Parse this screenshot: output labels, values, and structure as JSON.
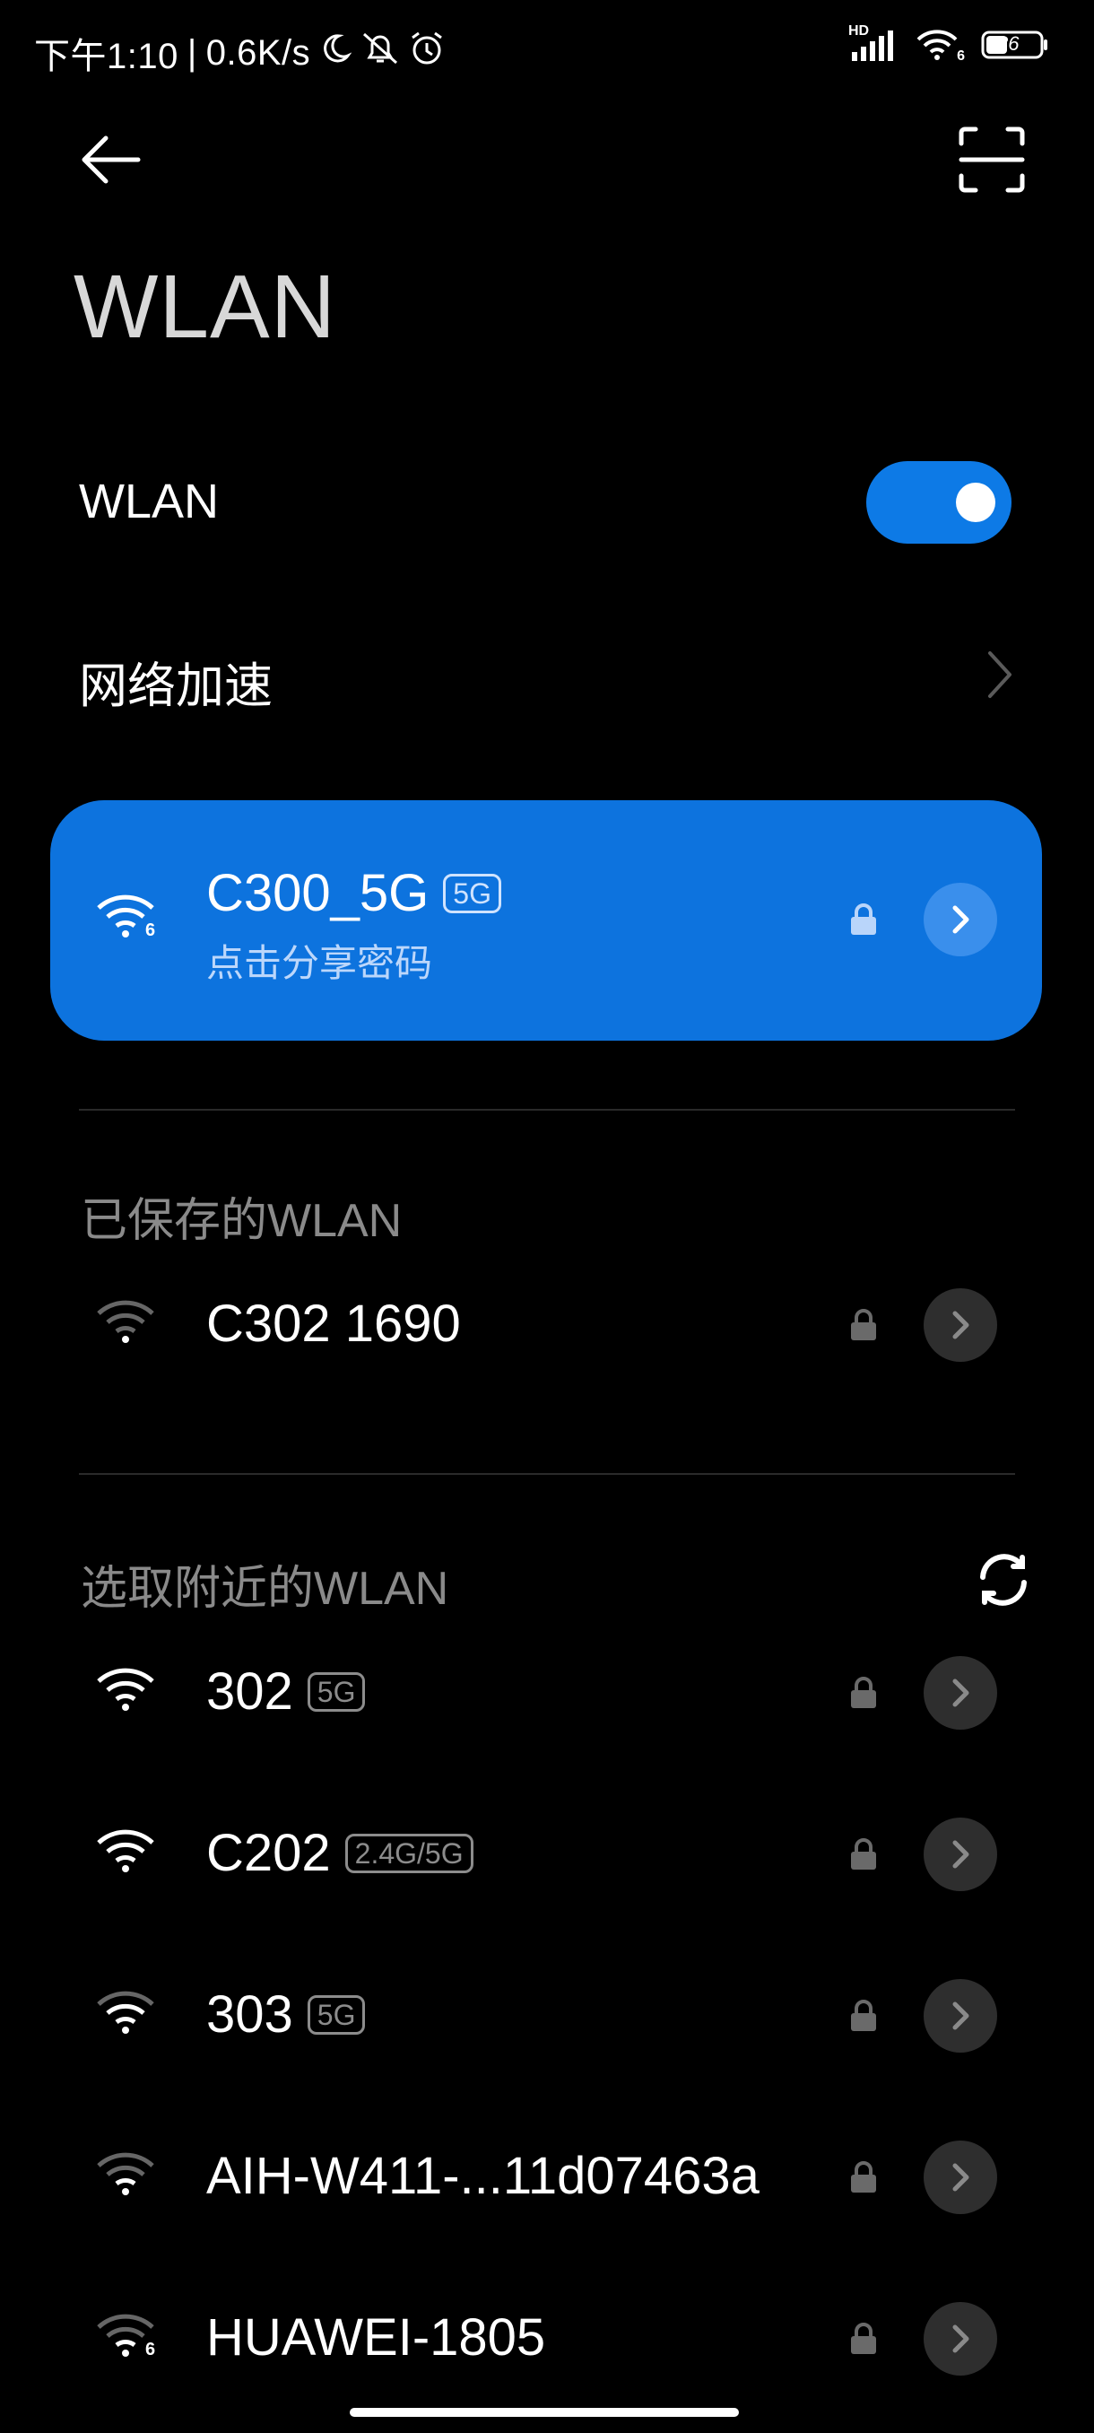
{
  "status_bar": {
    "time": "下午1:10",
    "separator": "|",
    "speed": "0.6K/s",
    "network_label": "HD",
    "wifi_sub": "6",
    "battery": "36",
    "icons": [
      "moon-icon",
      "muted-bell-icon",
      "alarm-icon",
      "signal-icon",
      "wifi-icon",
      "battery-icon"
    ]
  },
  "header": {
    "title": "WLAN",
    "icons": [
      "back-arrow-icon",
      "scan-qr-icon"
    ]
  },
  "wlan_toggle": {
    "label": "WLAN",
    "on": true
  },
  "network_accel": {
    "label": "网络加速"
  },
  "connected": {
    "name": "C300_5G",
    "band": "5G",
    "subtitle": "点击分享密码",
    "wifi_gen": "6",
    "color": "#0d73de"
  },
  "saved": {
    "title": "已保存的WLAN",
    "items": [
      {
        "name": "C302 1690"
      }
    ]
  },
  "nearby": {
    "title": "选取附近的WLAN",
    "items": [
      {
        "name": "302",
        "band": "5G"
      },
      {
        "name": "C202",
        "band": "2.4G/5G"
      },
      {
        "name": "303",
        "band": "5G"
      },
      {
        "name": "AIH-W411-...11d07463a",
        "band": ""
      },
      {
        "name": "HUAWEI-1805",
        "band": "",
        "wifi_gen": "6"
      }
    ]
  },
  "colors": {
    "accent": "#0d7ae6",
    "background": "#000000"
  }
}
